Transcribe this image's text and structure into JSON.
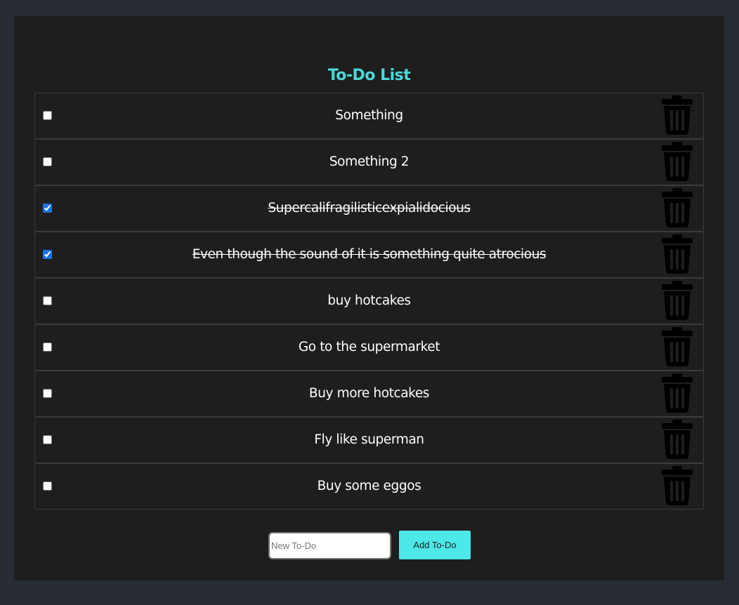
{
  "app": {
    "title": "To-Do List"
  },
  "todos": [
    {
      "text": "Something",
      "done": false
    },
    {
      "text": "Something 2",
      "done": false
    },
    {
      "text": "Supercalifragilisticexpialidocious",
      "done": true
    },
    {
      "text": "Even though the sound of it is something quite atrocious",
      "done": true
    },
    {
      "text": "buy hotcakes",
      "done": false
    },
    {
      "text": "Go to the supermarket",
      "done": false
    },
    {
      "text": "Buy more hotcakes",
      "done": false
    },
    {
      "text": "Fly like superman",
      "done": false
    },
    {
      "text": "Buy some eggos",
      "done": false
    }
  ],
  "new_todo": {
    "value": "",
    "placeholder": "New To-Do",
    "button_label": "Add To-Do"
  },
  "icons": {
    "delete": "trash-icon"
  },
  "colors": {
    "page_bg": "#282c34",
    "panel_bg": "#1e1e1e",
    "accent": "#4de8e8",
    "title": "#4cd8d8",
    "text": "#ffffff",
    "checkbox": "#1a73e8"
  }
}
